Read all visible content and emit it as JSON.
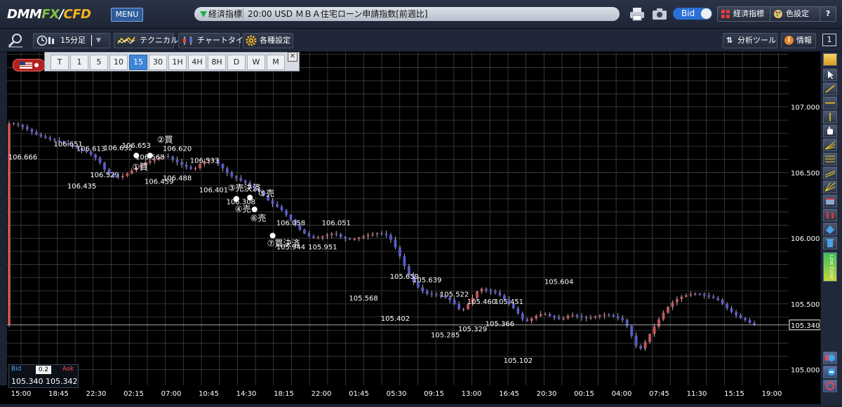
{
  "app": {
    "logo": "DMM FX/CFD",
    "menu": "MENU"
  },
  "ticker": {
    "label": "経済指標",
    "message": "20:00 USD ＭＢＡ住宅ローン申請指数[前週比]"
  },
  "header": {
    "bid_toggle": "Bid",
    "keizai": "経済指標",
    "iro": "色設定",
    "help": "?"
  },
  "toolbar": {
    "timeframe": "15分足",
    "technical": "テクニカル",
    "chart_type": "チャートタイプ",
    "settings": "各種設定",
    "analysis": "分析ツール",
    "info": "情報",
    "page": "1"
  },
  "timeframes": {
    "items": [
      "T",
      "1",
      "5",
      "10",
      "15",
      "30",
      "1H",
      "4H",
      "8H",
      "D",
      "W",
      "M"
    ],
    "selected": "15",
    "close": "✕"
  },
  "bidask": {
    "bid_label": "Bid",
    "spread": "0.2",
    "ask_label": "Ask",
    "bid": "105.340",
    "ask": "105.342"
  },
  "colors": {
    "bg": "#000000",
    "grid": "#4a4a4a",
    "up": "#c85656",
    "down": "#5a5ac8",
    "axis_text": "#ffffff",
    "current_price_box": "#ffffff"
  },
  "chart_data": {
    "type": "candlestick",
    "ylim": [
      104.88,
      107.42
    ],
    "yticks": [
      "107.000",
      "106.500",
      "106.000",
      "105.500",
      "105.000"
    ],
    "ytick_values": [
      107.0,
      106.5,
      106.0,
      105.5,
      105.0
    ],
    "xticks": [
      "15:00",
      "18:45",
      "22:30",
      "02:15",
      "07:00",
      "10:45",
      "14:30",
      "18:15",
      "22:00",
      "01:45",
      "05:30",
      "09:15",
      "13:00",
      "16:45",
      "20:30",
      "00:15",
      "04:00",
      "07:45",
      "11:30",
      "15:15",
      "19:00"
    ],
    "current_price": "105.340",
    "current_price_value": 105.34,
    "path": [
      [
        0,
        106.88
      ],
      [
        3,
        106.86
      ],
      [
        5,
        106.82
      ],
      [
        7,
        106.78
      ],
      [
        9,
        106.76
      ],
      [
        11,
        106.74
      ],
      [
        13,
        106.72
      ],
      [
        16,
        106.68
      ],
      [
        18,
        106.65
      ],
      [
        20,
        106.6
      ],
      [
        22,
        106.5
      ],
      [
        24,
        106.46
      ],
      [
        26,
        106.48
      ],
      [
        28,
        106.53
      ],
      [
        30,
        106.57
      ],
      [
        33,
        106.61
      ],
      [
        35,
        106.63
      ],
      [
        37,
        106.59
      ],
      [
        39,
        106.55
      ],
      [
        41,
        106.52
      ],
      [
        43,
        106.58
      ],
      [
        45,
        106.61
      ],
      [
        47,
        106.55
      ],
      [
        49,
        106.48
      ],
      [
        51,
        106.45
      ],
      [
        53,
        106.41
      ],
      [
        55,
        106.37
      ],
      [
        57,
        106.31
      ],
      [
        58,
        106.27
      ],
      [
        60,
        106.23
      ],
      [
        62,
        106.16
      ],
      [
        64,
        106.08
      ],
      [
        66,
        106.02
      ],
      [
        68,
        106.0
      ],
      [
        70,
        106.02
      ],
      [
        72,
        106.04
      ],
      [
        74,
        106.0
      ],
      [
        76,
        105.99
      ],
      [
        78,
        106.01
      ],
      [
        80,
        106.03
      ],
      [
        82,
        106.04
      ],
      [
        84,
        106.02
      ],
      [
        86,
        105.9
      ],
      [
        88,
        105.75
      ],
      [
        90,
        105.64
      ],
      [
        92,
        105.58
      ],
      [
        94,
        105.57
      ],
      [
        96,
        105.56
      ],
      [
        98,
        105.52
      ],
      [
        100,
        105.44
      ],
      [
        102,
        105.52
      ],
      [
        104,
        105.62
      ],
      [
        106,
        105.6
      ],
      [
        108,
        105.58
      ],
      [
        110,
        105.52
      ],
      [
        112,
        105.45
      ],
      [
        114,
        105.36
      ],
      [
        116,
        105.4
      ],
      [
        118,
        105.43
      ],
      [
        120,
        105.4
      ],
      [
        122,
        105.38
      ],
      [
        124,
        105.42
      ],
      [
        126,
        105.4
      ],
      [
        128,
        105.39
      ],
      [
        130,
        105.41
      ],
      [
        132,
        105.42
      ],
      [
        134,
        105.4
      ],
      [
        136,
        105.37
      ],
      [
        138,
        105.22
      ],
      [
        139,
        105.14
      ],
      [
        140,
        105.18
      ],
      [
        142,
        105.3
      ],
      [
        144,
        105.41
      ],
      [
        146,
        105.5
      ],
      [
        148,
        105.55
      ],
      [
        150,
        105.57
      ],
      [
        152,
        105.58
      ],
      [
        154,
        105.56
      ],
      [
        156,
        105.54
      ],
      [
        157,
        105.52
      ],
      [
        159,
        105.45
      ],
      [
        161,
        105.4
      ],
      [
        163,
        105.37
      ],
      [
        164,
        105.34
      ]
    ],
    "price_labels": [
      {
        "text": "106.666",
        "i": 3,
        "v": 106.6
      },
      {
        "text": "106.651",
        "i": 13,
        "v": 106.7
      },
      {
        "text": "106.613",
        "i": 18,
        "v": 106.665
      },
      {
        "text": "106.632",
        "i": 24,
        "v": 106.67
      },
      {
        "text": "106.653",
        "i": 28,
        "v": 106.69
      },
      {
        "text": "106.568",
        "i": 31,
        "v": 106.6
      },
      {
        "text": "106.620",
        "i": 37,
        "v": 106.665
      },
      {
        "text": "106.435",
        "i": 16,
        "v": 106.38
      },
      {
        "text": "106.529",
        "i": 21,
        "v": 106.465
      },
      {
        "text": "106.459",
        "i": 33,
        "v": 106.415
      },
      {
        "text": "106.488",
        "i": 37,
        "v": 106.44
      },
      {
        "text": "106.533",
        "i": 43,
        "v": 106.575
      },
      {
        "text": "106.401",
        "i": 45,
        "v": 106.35
      },
      {
        "text": "106.308",
        "i": 51,
        "v": 106.26
      },
      {
        "text": "106.058",
        "i": 62,
        "v": 106.1
      },
      {
        "text": "106.051",
        "i": 72,
        "v": 106.1
      },
      {
        "text": "105.944",
        "i": 62,
        "v": 105.915
      },
      {
        "text": "105.951",
        "i": 69,
        "v": 105.915
      },
      {
        "text": "105.659",
        "i": 87,
        "v": 105.69
      },
      {
        "text": "105.639",
        "i": 92,
        "v": 105.665
      },
      {
        "text": "105.568",
        "i": 78,
        "v": 105.525
      },
      {
        "text": "105.402",
        "i": 85,
        "v": 105.37
      },
      {
        "text": "105.522",
        "i": 98,
        "v": 105.555
      },
      {
        "text": "105.460",
        "i": 104,
        "v": 105.5
      },
      {
        "text": "105.451",
        "i": 110,
        "v": 105.5
      },
      {
        "text": "105.285",
        "i": 96,
        "v": 105.245
      },
      {
        "text": "105.329",
        "i": 102,
        "v": 105.29
      },
      {
        "text": "105.366",
        "i": 108,
        "v": 105.33
      },
      {
        "text": "105.604",
        "i": 121,
        "v": 105.65
      },
      {
        "text": "105.102",
        "i": 112,
        "v": 105.05
      }
    ],
    "trade_marks": [
      {
        "text": "①買",
        "i": 28,
        "lx": -6,
        "v": 106.63,
        "ly": 106.52
      },
      {
        "text": "②買",
        "i": 31,
        "lx": 10,
        "v": 106.63,
        "ly": 106.73
      },
      {
        "text": "③売決済",
        "i": 50,
        "lx": -12,
        "v": 106.3,
        "ly": 106.36
      },
      {
        "text": "④売",
        "i": 50,
        "lx": -2,
        "v": 106.3,
        "ly": 106.2
      },
      {
        "text": "⑤売",
        "i": 53,
        "lx": 12,
        "v": 106.31,
        "ly": 106.32
      },
      {
        "text": "⑥売",
        "i": 54,
        "lx": -6,
        "v": 106.22,
        "ly": 106.13
      },
      {
        "text": "⑦買決済",
        "i": 58,
        "lx": -8,
        "v": 106.02,
        "ly": 105.94
      }
    ]
  }
}
